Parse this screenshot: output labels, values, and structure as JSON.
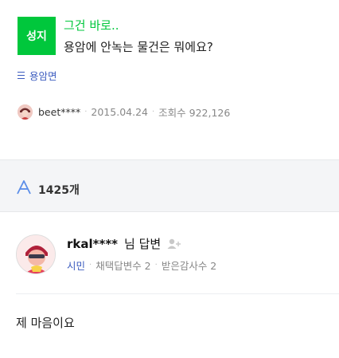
{
  "question": {
    "badge": "성지",
    "tag": "그건 바로..",
    "title": "용암에 안녹는 물건은 뭐에요?",
    "category": "용암면",
    "author": "beet****",
    "date": "2015.04.24",
    "views": "조회수 922,126"
  },
  "answers": {
    "count": "1425개"
  },
  "answer": {
    "author": "rkal****",
    "suffix": "님 답변",
    "grade": "시민",
    "adopted": "채택답변수 2",
    "thanks": "받은감사수 2",
    "body": "제 마음이요"
  },
  "colors": {
    "brand_green": "#00c73c",
    "link_blue": "#3c5cbf",
    "answer_icon_blue": "#5a8de8"
  }
}
